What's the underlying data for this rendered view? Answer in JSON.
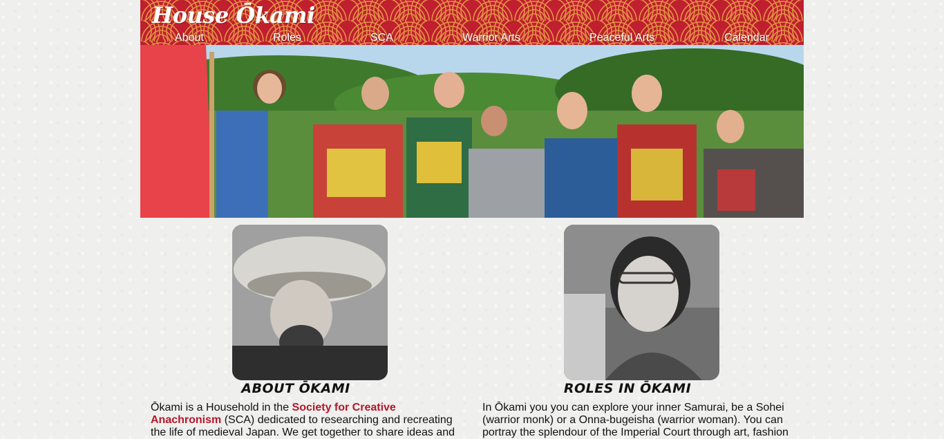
{
  "brand": "House Ōkami",
  "nav": [
    {
      "label": "About"
    },
    {
      "label": "Roles"
    },
    {
      "label": "SCA"
    },
    {
      "label": "Warrior Arts"
    },
    {
      "label": "Peaceful Arts"
    },
    {
      "label": "Calendar"
    }
  ],
  "colors": {
    "accent": "#bf1f2e",
    "link": "#b5172a"
  },
  "about": {
    "title": "ABOUT ŌKAMI",
    "text_before": "Ōkami is a Household in the ",
    "link": "Society for Creative Anachronism",
    "text_after": " (SCA) dedicated to researching and recreating the life of medieval Japan. We get together to share ideas and"
  },
  "roles": {
    "title": "ROLES IN ŌKAMI",
    "text": "In Ōkami you you can explore your inner Samurai, be a Sohei (warrior monk) or a Onna-bugeisha (warrior woman). You can portray the splendour of the Imperial Court through art, fashion"
  }
}
